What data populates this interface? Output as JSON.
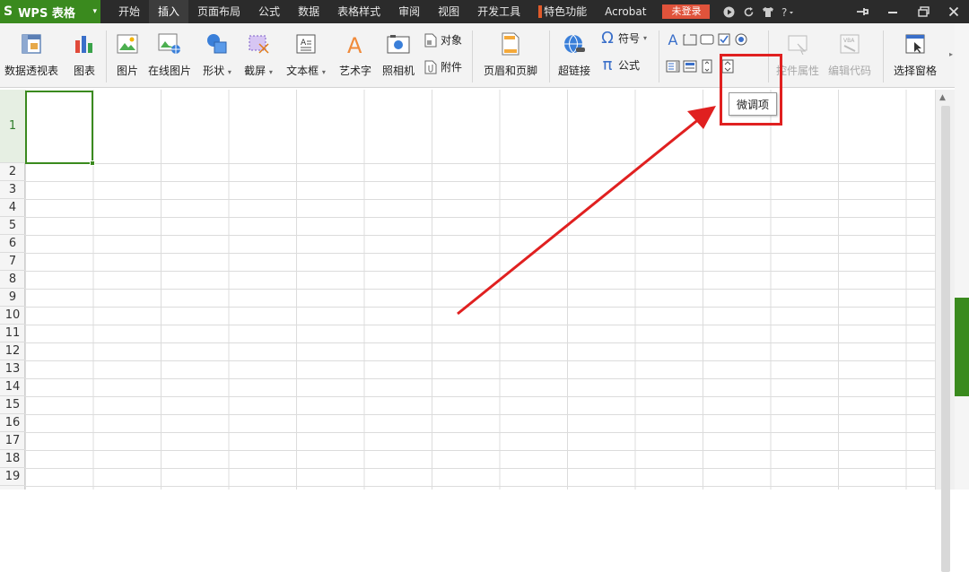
{
  "app": {
    "logo": "S",
    "name": "WPS 表格",
    "caret": "▾"
  },
  "tabs": [
    {
      "label": "开始"
    },
    {
      "label": "插入"
    },
    {
      "label": "页面布局"
    },
    {
      "label": "公式"
    },
    {
      "label": "数据"
    },
    {
      "label": "表格样式"
    },
    {
      "label": "审阅"
    },
    {
      "label": "视图"
    },
    {
      "label": "开发工具"
    },
    {
      "label": "特色功能"
    },
    {
      "label": "Acrobat"
    }
  ],
  "login_label": "未登录",
  "ribbon": {
    "pivot": "数据透视表",
    "chart": "图表",
    "picture": "图片",
    "online_picture": "在线图片",
    "shapes": "形状",
    "screenshot": "截屏",
    "textbox": "文本框",
    "wordart": "艺术字",
    "camera": "照相机",
    "object": "对象",
    "attachment": "附件",
    "header_footer": "页眉和页脚",
    "hyperlink": "超链接",
    "symbol": "符号",
    "equation": "公式",
    "control_props": "控件属性",
    "edit_code": "编辑代码",
    "select_pane": "选择窗格",
    "dropdown_caret": "▾"
  },
  "tooltip": "微调项",
  "rows": [
    "1",
    "2",
    "3",
    "4",
    "5",
    "6",
    "7",
    "8",
    "9",
    "10",
    "11",
    "12",
    "13",
    "14",
    "15",
    "16",
    "17",
    "18",
    "19"
  ],
  "colors": {
    "accent": "#3a8a1e",
    "annotation": "#e02020",
    "topbar": "#2b2b2b"
  }
}
